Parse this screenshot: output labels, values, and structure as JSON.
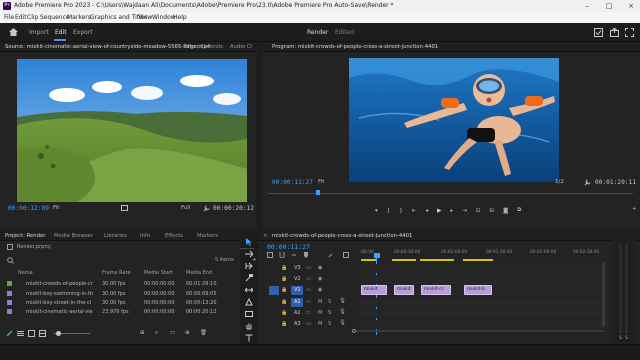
{
  "window": {
    "title": "Adobe Premiere Pro 2023 - C:\\Users\\Wajdaan Ali\\Documents\\Adobe\\Premiere Pro\\23.0\\Adobe Premiere Pro Auto-Save\\Render *",
    "logo_text": "Pr"
  },
  "menu": [
    "File",
    "Edit",
    "Clip",
    "Sequence",
    "Markers",
    "Graphics and Titles",
    "View",
    "Window",
    "Help"
  ],
  "workspace": {
    "tabs": [
      "Import",
      "Edit",
      "Export"
    ],
    "active_tab": "Edit",
    "project_name": "Render",
    "project_status": "Edited"
  },
  "source_monitor": {
    "tabs": [
      "Source: mixkit-cinematic-aerial-view-of-countryside-meadow-5565-large.mp4",
      "Effect Controls",
      "Audio Cl"
    ],
    "timecode_in": "00:00:12:09",
    "fit": "Fit",
    "quality": "Full",
    "timecode_out": "00:00:20:12"
  },
  "program_monitor": {
    "title": "Program: mixkit-crowds-of-people-cross-a-street-junction-4401",
    "timecode_in": "00:00:11:27",
    "fit": "Fit",
    "quality": "1/2",
    "timecode_out": "00:01:29:11"
  },
  "project_panel": {
    "tabs": [
      "Project: Render",
      "Media Browser",
      "Libraries",
      "Info",
      "Effects",
      "Markers"
    ],
    "project_file": "Render.prproj",
    "items_count": "5 items",
    "columns": [
      "Name",
      "Frame Rate",
      "Media Start",
      "Media End"
    ],
    "rows": [
      {
        "name": "mixkit-crowds-of-people-cr",
        "fps": "30.00 fps",
        "start": "00:00:00:00",
        "end": "00:01:29:10",
        "color": "#5aaa4a"
      },
      {
        "name": "mixkit-boy-swimming-in-th",
        "fps": "30.00 fps",
        "start": "00:00:00:00",
        "end": "00:00:09:05",
        "color": "#8b7fd6"
      },
      {
        "name": "mixkit-boy-street-in-the-cl",
        "fps": "30.00 fps",
        "start": "00:00:00:00",
        "end": "00:00:13:20",
        "color": "#8b7fd6"
      },
      {
        "name": "mixkit-cinematic-aerial-vie",
        "fps": "23.976 fps",
        "start": "00:00:00:00",
        "end": "00:00:20:12",
        "color": "#8b7fd6"
      }
    ]
  },
  "timeline": {
    "sequence_tab": "mixkit-crowds-of-people-cross-a-street-junction-4401",
    "timecode": "00:00:11:27",
    "ruler": [
      ":00:00",
      "00:00:30:00",
      "00:01:00:00",
      "00:01:30:00",
      "00:02:00:00",
      "00:02:30:00"
    ],
    "video_tracks": [
      "V3",
      "V2",
      "V1"
    ],
    "audio_tracks": [
      "A1",
      "A2",
      "A3"
    ],
    "clips": [
      "mixkit",
      "mixkit",
      "mixkit-cr",
      "mixkit-b"
    ],
    "audio_meter_labels": [
      "S",
      "S"
    ]
  }
}
